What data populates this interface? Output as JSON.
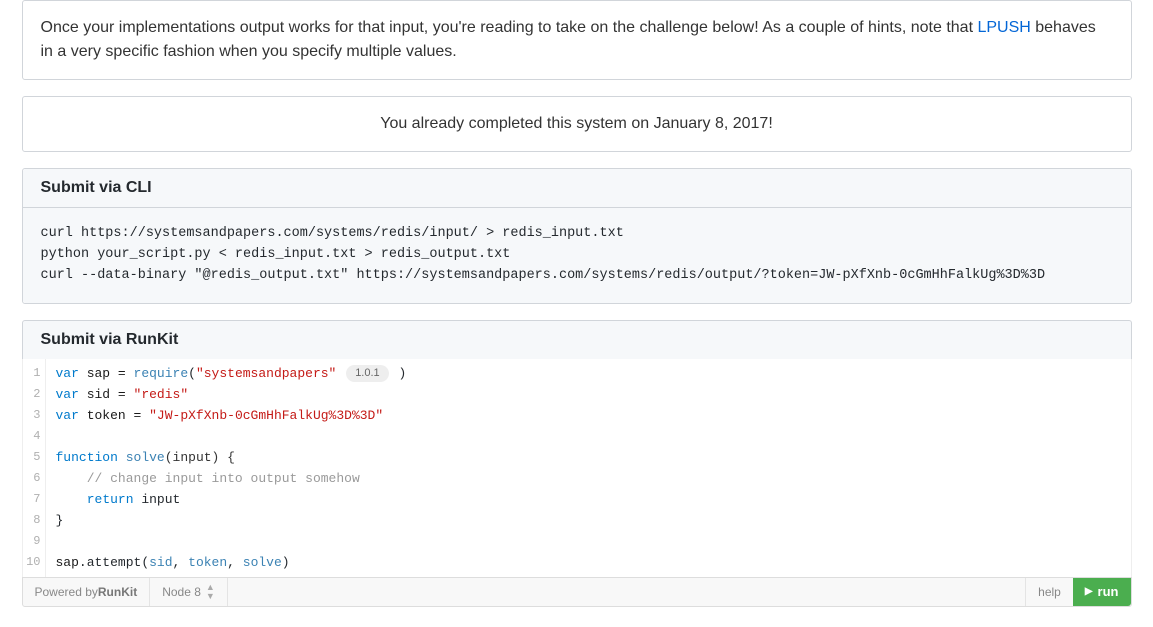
{
  "intro": {
    "text_before_link": "Once your implementations output works for that input, you're reading to take on the challenge below! As a couple of hints, note that ",
    "link_text": "LPUSH",
    "text_after_link": " behaves in a very specific fashion when you specify multiple values."
  },
  "completed_text": "You already completed this system on January 8, 2017!",
  "cli": {
    "title": "Submit via CLI",
    "code": "curl https://systemsandpapers.com/systems/redis/input/ > redis_input.txt\npython your_script.py < redis_input.txt > redis_output.txt\ncurl --data-binary \"@redis_output.txt\" https://systemsandpapers.com/systems/redis/output/?token=JW-pXfXnb-0cGmHhFalkUg%3D%3D"
  },
  "runkit": {
    "title": "Submit via RunKit",
    "package_version": "1.0.1",
    "lines": {
      "l1_var": "var",
      "l1_id": " sap = ",
      "l1_fn": "require",
      "l1_paren_open": "(",
      "l1_str": "\"systemsandpapers\"",
      "l1_paren_close": ")",
      "l2_var": "var",
      "l2_id": " sid = ",
      "l2_str": "\"redis\"",
      "l3_var": "var",
      "l3_id": " token = ",
      "l3_str": "\"JW-pXfXnb-0cGmHhFalkUg%3D%3D\"",
      "l5_kw": "function",
      "l5_name": " solve",
      "l5_params": "(input) {",
      "l6_comment": "    // change input into output somehow",
      "l7_indent": "    ",
      "l7_kw": "return",
      "l7_rest": " input",
      "l8": "}",
      "l10_obj": "sap",
      "l10_dot": ".attempt(",
      "l10_a1": "sid",
      "l10_c1": ", ",
      "l10_a2": "token",
      "l10_c2": ", ",
      "l10_a3": "solve",
      "l10_close": ")"
    },
    "footer": {
      "powered_prefix": "Powered by ",
      "powered_brand": "RunKit",
      "node_label": "Node 8",
      "help_label": "help",
      "run_label": "run"
    }
  },
  "line_numbers": [
    "1",
    "2",
    "3",
    "4",
    "5",
    "6",
    "7",
    "8",
    "9",
    "10"
  ]
}
